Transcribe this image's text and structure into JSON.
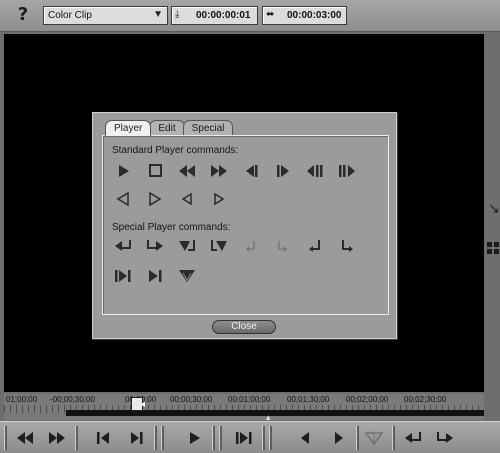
{
  "toolbar": {
    "help_glyph": "?",
    "clip_type": "Color Clip",
    "in_icon": "mark-in-icon",
    "in_time": "00:00:00:01",
    "duration_icon": "duration-icon",
    "duration_time": "00:00:03:00"
  },
  "dialog": {
    "tabs": [
      {
        "label": "Player",
        "active": true
      },
      {
        "label": "Edit",
        "active": false
      },
      {
        "label": "Special",
        "active": false
      }
    ],
    "standard_label": "Standard Player commands:",
    "special_label": "Special Player commands:",
    "standard_row1": [
      "play-icon",
      "stop-icon",
      "rewind-icon",
      "fast-forward-icon",
      "step-back-icon",
      "step-forward-icon",
      "prev-frame-icon",
      "next-frame-icon"
    ],
    "standard_row2": [
      "play-reverse-icon",
      "play-forward-icon",
      "slow-reverse-icon",
      "slow-forward-icon"
    ],
    "special_row1": [
      "insert-left-icon",
      "insert-right-icon",
      "overwrite-left-icon",
      "overwrite-right-icon",
      "mark-in-disabled-icon",
      "mark-out-disabled-icon",
      "go-in-icon",
      "go-out-icon"
    ],
    "special_row2": [
      "goto-start-icon",
      "goto-end-icon",
      "trim-icon"
    ],
    "close_label": "Close"
  },
  "timeline": {
    "ticks": [
      "01;00;00",
      "-00;00;30;00",
      "00;00;00",
      "00;00;30;00",
      "00;01;00;00",
      "00;01;30;00",
      "00;02;00;00",
      "00;02;30;00"
    ]
  },
  "transport": {
    "buttons": [
      "rewind-icon",
      "fast-forward-icon",
      "step-back-icon",
      "step-forward-icon",
      "play-icon",
      "pause-icon",
      "end-icon",
      "prev-icon",
      "next-icon",
      "trim-disabled-icon",
      "insert-icon",
      "overwrite-icon"
    ]
  }
}
